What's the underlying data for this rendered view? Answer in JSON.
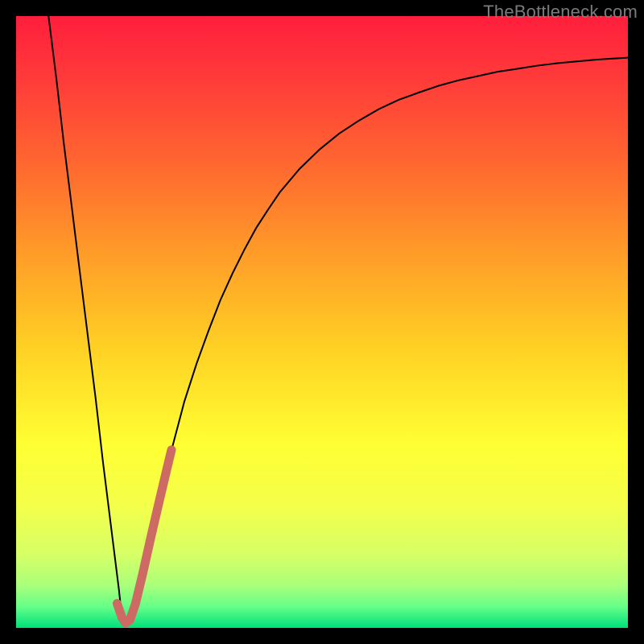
{
  "watermark": "TheBottleneck.com",
  "gradient": {
    "stops": [
      {
        "offset": 0.0,
        "color": "#ff1e3c"
      },
      {
        "offset": 0.1,
        "color": "#ff3a3a"
      },
      {
        "offset": 0.25,
        "color": "#ff6a2f"
      },
      {
        "offset": 0.4,
        "color": "#ffa028"
      },
      {
        "offset": 0.55,
        "color": "#ffd324"
      },
      {
        "offset": 0.7,
        "color": "#ffff33"
      },
      {
        "offset": 0.8,
        "color": "#f4ff4a"
      },
      {
        "offset": 0.88,
        "color": "#d6ff66"
      },
      {
        "offset": 0.93,
        "color": "#aaff7a"
      },
      {
        "offset": 0.965,
        "color": "#66ff88"
      },
      {
        "offset": 1.0,
        "color": "#00e07a"
      }
    ]
  },
  "chart_data": {
    "type": "line",
    "title": "",
    "xlabel": "",
    "ylabel": "",
    "xlim": [
      0,
      100
    ],
    "ylim": [
      0,
      100
    ],
    "grid": false,
    "note": "x and y are percent of the plotting area; raw curve shape read from pixels (no axis ticks present).",
    "series": [
      {
        "name": "curve",
        "color": "#000000",
        "width": 2.0,
        "points": [
          [
            5.3,
            100.0
          ],
          [
            6.6,
            89.6
          ],
          [
            7.8,
            79.2
          ],
          [
            9.1,
            68.8
          ],
          [
            10.4,
            58.3
          ],
          [
            11.7,
            47.9
          ],
          [
            13.0,
            37.5
          ],
          [
            14.2,
            27.1
          ],
          [
            15.5,
            16.7
          ],
          [
            16.8,
            6.3
          ],
          [
            17.3,
            1.7
          ],
          [
            17.7,
            0.6
          ],
          [
            18.4,
            1.0
          ],
          [
            19.2,
            3.0
          ],
          [
            20.4,
            7.8
          ],
          [
            21.7,
            13.4
          ],
          [
            23.0,
            19.1
          ],
          [
            24.3,
            24.5
          ],
          [
            25.6,
            29.8
          ],
          [
            27.5,
            37.0
          ],
          [
            29.5,
            43.2
          ],
          [
            31.5,
            48.7
          ],
          [
            33.4,
            53.6
          ],
          [
            35.4,
            58.0
          ],
          [
            37.3,
            61.8
          ],
          [
            39.2,
            65.3
          ],
          [
            41.2,
            68.4
          ],
          [
            43.1,
            71.2
          ],
          [
            46.3,
            75.0
          ],
          [
            49.6,
            78.2
          ],
          [
            52.8,
            80.8
          ],
          [
            56.0,
            82.9
          ],
          [
            59.3,
            84.8
          ],
          [
            62.5,
            86.3
          ],
          [
            65.8,
            87.5
          ],
          [
            69.0,
            88.6
          ],
          [
            72.3,
            89.5
          ],
          [
            75.5,
            90.2
          ],
          [
            78.7,
            90.9
          ],
          [
            82.0,
            91.4
          ],
          [
            85.2,
            91.9
          ],
          [
            88.5,
            92.3
          ],
          [
            91.7,
            92.6
          ],
          [
            95.0,
            92.9
          ],
          [
            98.2,
            93.1
          ],
          [
            100.0,
            93.2
          ]
        ]
      },
      {
        "name": "highlight",
        "color": "#cc6a63",
        "width": 11,
        "linecap": "round",
        "points": [
          [
            16.5,
            4.0
          ],
          [
            17.3,
            1.7
          ],
          [
            17.9,
            0.8
          ],
          [
            18.6,
            1.3
          ],
          [
            19.5,
            3.9
          ],
          [
            20.7,
            8.9
          ],
          [
            22.0,
            14.7
          ],
          [
            23.3,
            20.3
          ],
          [
            24.6,
            25.8
          ],
          [
            25.4,
            29.1
          ]
        ]
      }
    ]
  }
}
